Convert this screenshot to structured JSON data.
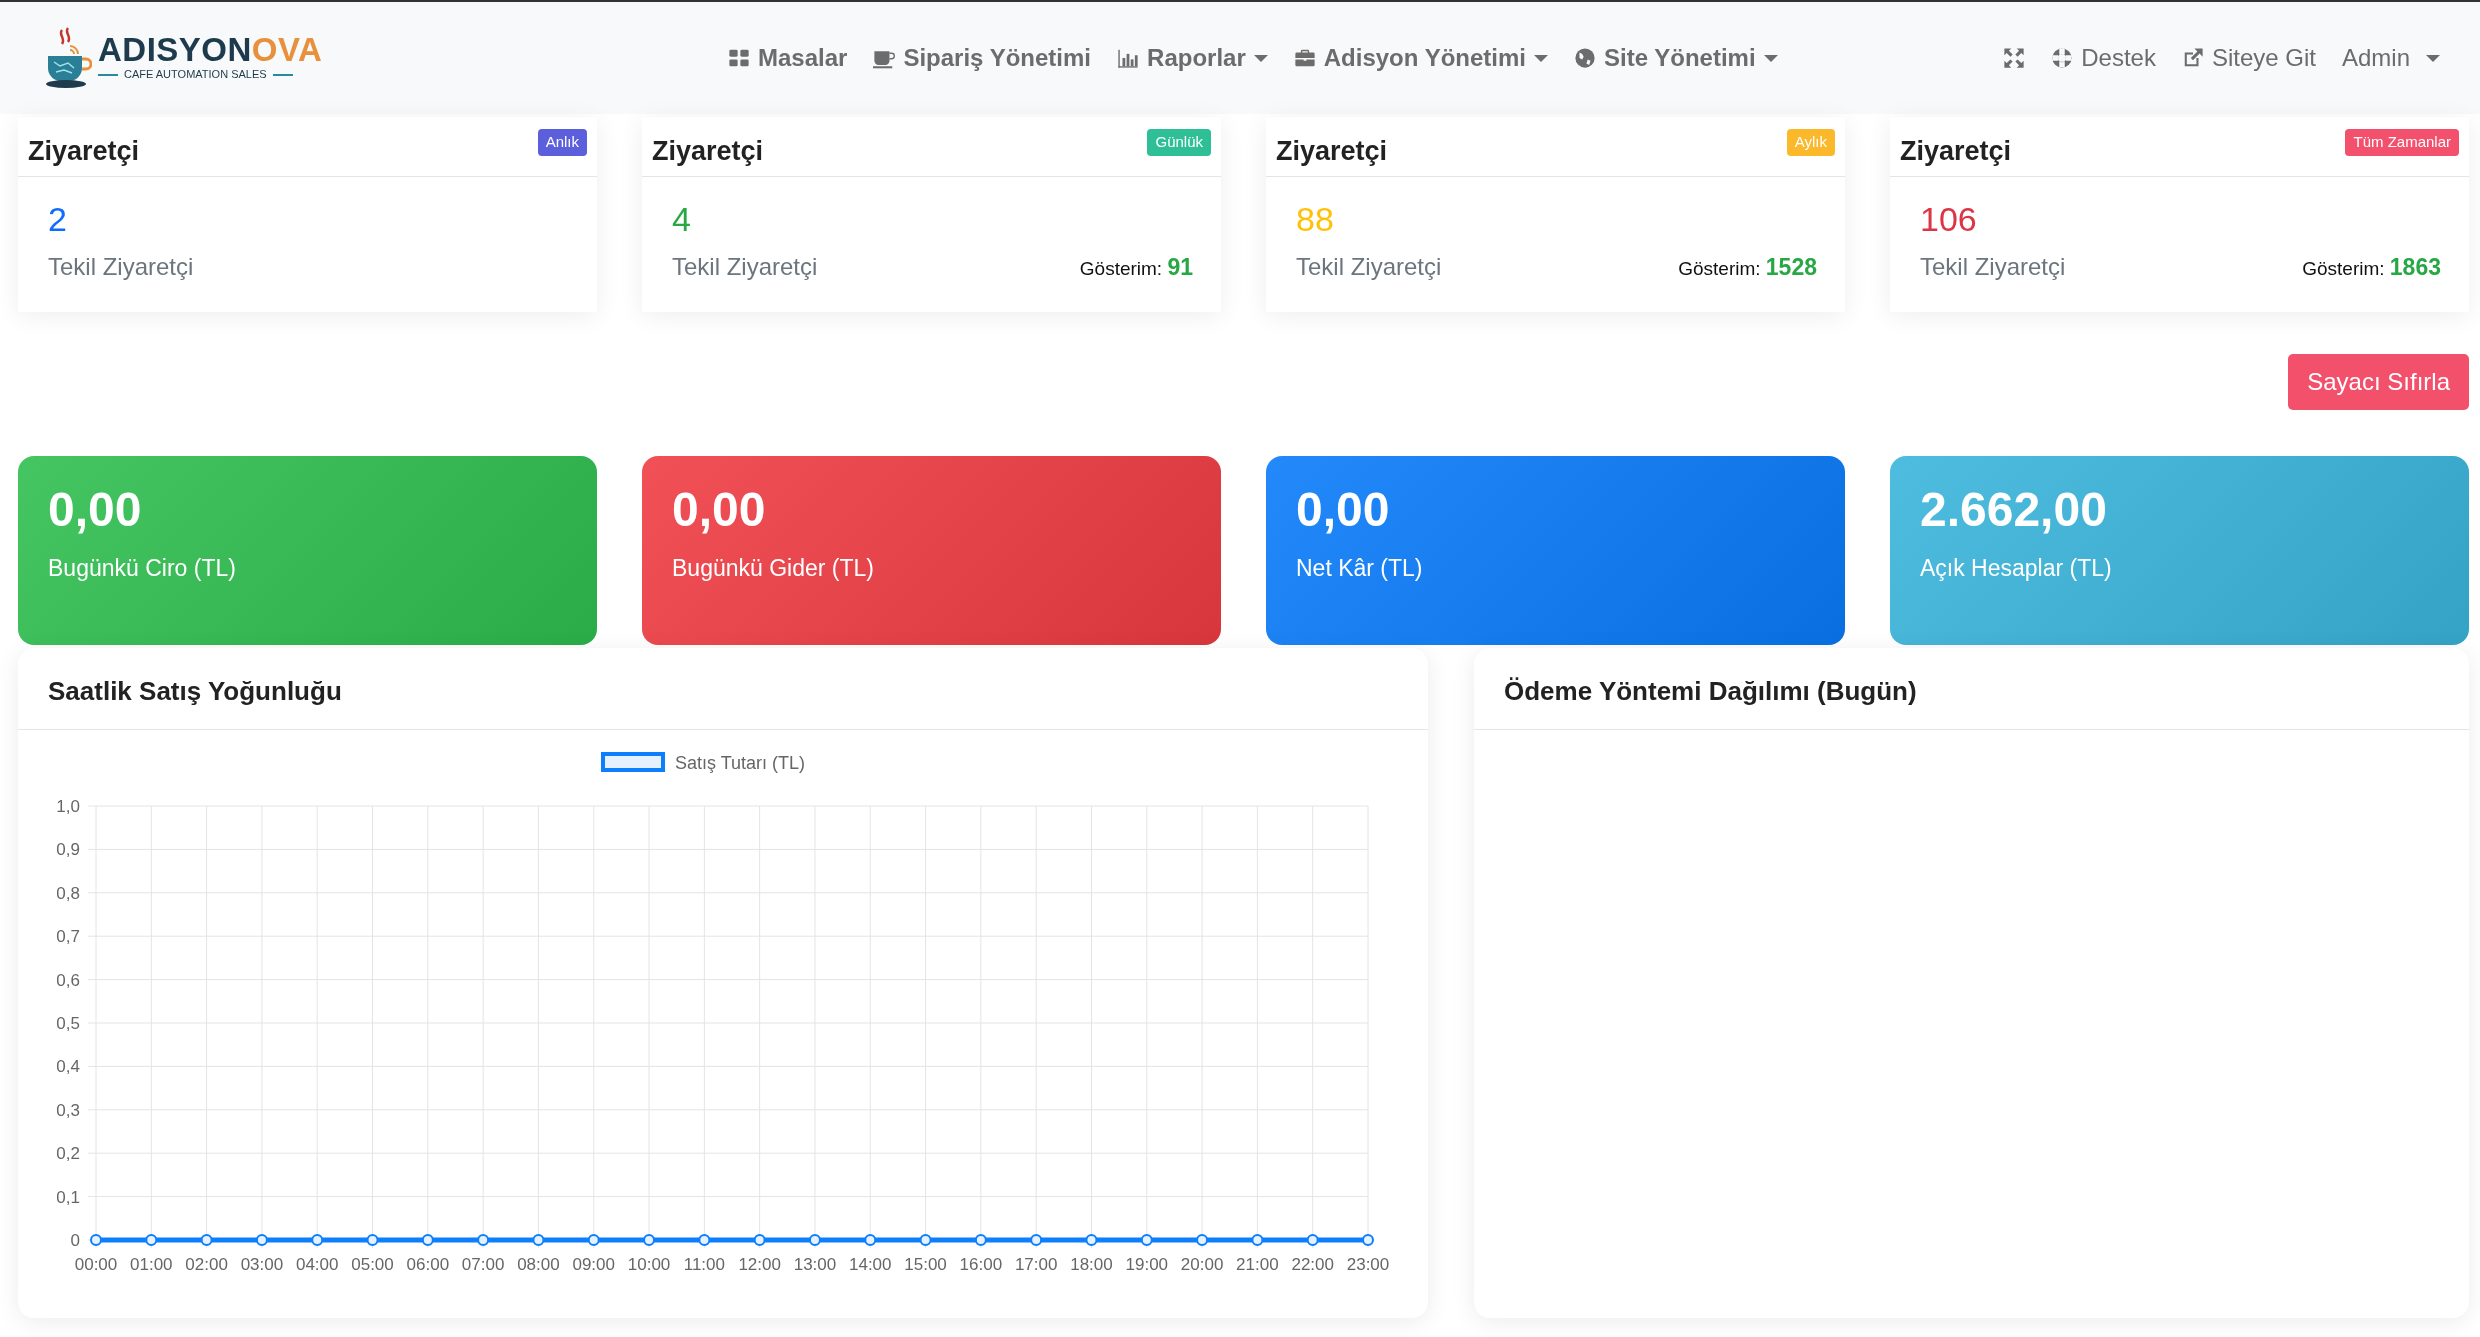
{
  "brand": {
    "wordmark": [
      "ADISYON",
      "OVA"
    ],
    "tagline": "CAFE AUTOMATION SALES"
  },
  "nav": [
    {
      "label": "Masalar",
      "dropdown": false
    },
    {
      "label": "Sipariş Yönetimi",
      "dropdown": false
    },
    {
      "label": "Raporlar",
      "dropdown": true
    },
    {
      "label": "Adisyon Yönetimi",
      "dropdown": true
    },
    {
      "label": "Site Yönetimi",
      "dropdown": true
    }
  ],
  "nav_right": [
    {
      "kind": "icon"
    },
    {
      "kind": "link",
      "label": "Destek",
      "dropdown": false
    },
    {
      "kind": "link",
      "label": "Siteye Git",
      "dropdown": false
    },
    {
      "kind": "link",
      "label": "Admin",
      "dropdown": true
    }
  ],
  "visitor_cards": [
    {
      "title": "Ziyaretçi",
      "badge": {
        "label": "Anlık",
        "color": "#5b5fdc"
      },
      "value": "2",
      "color": "#0d6efd",
      "label": "Tekil Ziyaretçi"
    },
    {
      "title": "Ziyaretçi",
      "badge": {
        "label": "Günlük",
        "color": "#2ebf97"
      },
      "value": "4",
      "color": "#28a745",
      "label": "Tekil Ziyaretçi",
      "impressions_label": "Gösterim:",
      "impressions": "91"
    },
    {
      "title": "Ziyaretçi",
      "badge": {
        "label": "Aylık",
        "color": "#fbb82a"
      },
      "value": "88",
      "color": "#ffc107",
      "label": "Tekil Ziyaretçi",
      "impressions_label": "Gösterim:",
      "impressions": "1528"
    },
    {
      "title": "Ziyaretçi",
      "badge": {
        "label": "Tüm Zamanlar",
        "color": "#f2506c"
      },
      "value": "106",
      "color": "#dc3545",
      "label": "Tekil Ziyaretçi",
      "impressions_label": "Gösterim:",
      "impressions": "1863"
    }
  ],
  "reset_button": "Sayacı Sıfırla",
  "stat_cards": [
    {
      "value": "0,00",
      "label": "Bugünkü Ciro (TL)",
      "color": "#2fbf50"
    },
    {
      "value": "0,00",
      "label": "Bugünkü Gider (TL)",
      "color": "#ef3d43"
    },
    {
      "value": "0,00",
      "label": "Net Kâr (TL)",
      "color": "#0a7cfb"
    },
    {
      "value": "2.662,00",
      "label": "Açık Hesaplar (TL)",
      "color": "#3ab5dc"
    }
  ],
  "sales_chart": {
    "title": "Saatlik Satış Yoğunluğu",
    "chart_data": {
      "type": "line",
      "categories": [
        "00:00",
        "01:00",
        "02:00",
        "03:00",
        "04:00",
        "05:00",
        "06:00",
        "07:00",
        "08:00",
        "09:00",
        "10:00",
        "11:00",
        "12:00",
        "13:00",
        "14:00",
        "15:00",
        "16:00",
        "17:00",
        "18:00",
        "19:00",
        "20:00",
        "21:00",
        "22:00",
        "23:00"
      ],
      "series": [
        {
          "name": "Satış Tutarı (TL)",
          "color": "#0d7ffd",
          "values": [
            0,
            0,
            0,
            0,
            0,
            0,
            0,
            0,
            0,
            0,
            0,
            0,
            0,
            0,
            0,
            0,
            0,
            0,
            0,
            0,
            0,
            0,
            0,
            0
          ]
        }
      ],
      "ylim": [
        0,
        1
      ],
      "grid": true,
      "marker": true,
      "yticks": [
        {
          "value": 0,
          "label": "0"
        },
        {
          "value": 0.1,
          "label": "0,1"
        },
        {
          "value": 0.2,
          "label": "0,2"
        },
        {
          "value": 0.3,
          "label": "0,3"
        },
        {
          "value": 0.4,
          "label": "0,4"
        },
        {
          "value": 0.5,
          "label": "0,5"
        },
        {
          "value": 0.6,
          "label": "0,6"
        },
        {
          "value": 0.7,
          "label": "0,7"
        },
        {
          "value": 0.8,
          "label": "0,8"
        },
        {
          "value": 0.9,
          "label": "0,9"
        },
        {
          "value": 1,
          "label": "1,0"
        }
      ]
    }
  },
  "payment_chart": {
    "title": "Ödeme Yöntemi Dağılımı (Bugün)"
  }
}
